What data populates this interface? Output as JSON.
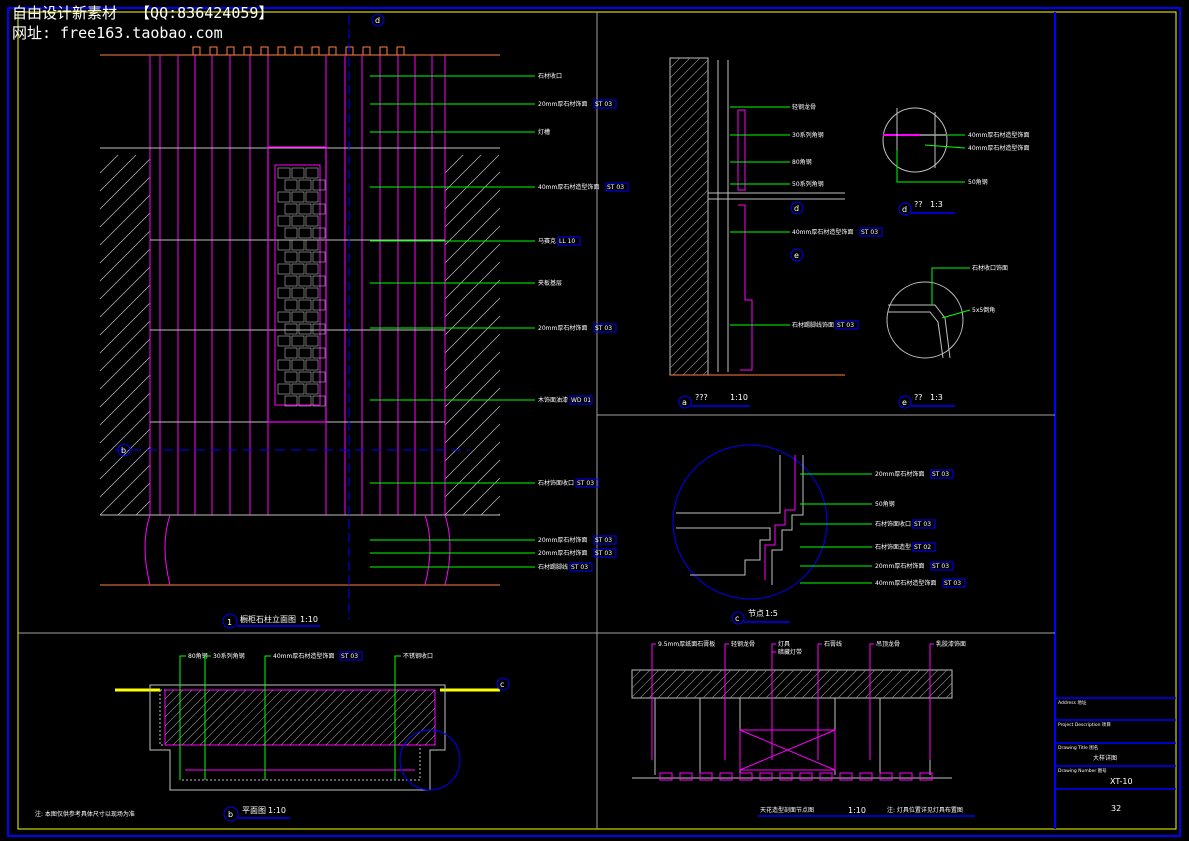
{
  "watermark": {
    "line1": "自由设计新素材  【QQ:836424059】",
    "line2": "网址: free163.taobao.com"
  },
  "colors": {
    "background": "#000000",
    "frame": "#ffff00",
    "border_blue": "#0000ff",
    "divider": "#a0a0a0",
    "leader": "#00ff00",
    "cabinet": "#ff00ff",
    "orange_line": "#ff8040",
    "hatch": "#c0c0c0"
  },
  "elevation": {
    "marker_top": "d",
    "marker_side": "b",
    "labels": [
      {
        "text": "石材收口",
        "code": ""
      },
      {
        "text": "20mm厚石材饰面",
        "code": "ST 03"
      },
      {
        "text": "灯槽",
        "code": ""
      },
      {
        "text": "40mm厚石材造型饰面",
        "code": "ST 03"
      },
      {
        "text": "马赛克",
        "code": "LL 10"
      },
      {
        "text": "夹板基层",
        "code": ""
      },
      {
        "text": "20mm厚石材饰面",
        "code": "ST 03"
      },
      {
        "text": "木饰面油漆",
        "code": "WD 01"
      },
      {
        "text": "石材饰面收口",
        "code": "ST 03"
      },
      {
        "text": "20mm厚石材饰面",
        "code": "ST 03"
      },
      {
        "text": "20mm厚石材饰面",
        "code": "ST 03"
      },
      {
        "text": "石材踢脚线",
        "code": "ST 03"
      }
    ],
    "caption": {
      "number": "1",
      "title": "橱柜石柱立面图",
      "scale": "1:10"
    }
  },
  "section_a": {
    "labels": [
      {
        "text": "轻钢龙骨",
        "code": ""
      },
      {
        "text": "30系列角钢",
        "code": ""
      },
      {
        "text": "80角钢",
        "code": ""
      },
      {
        "text": "50系列角钢",
        "code": ""
      },
      {
        "text": "40mm厚石材造型饰面",
        "code": "ST 03"
      },
      {
        "text": "石材踢脚线饰面",
        "code": "ST 03"
      }
    ],
    "markers": [
      "d",
      "e"
    ],
    "caption": {
      "number": "a",
      "title": "???",
      "scale": "1:10"
    }
  },
  "detail_d": {
    "labels": [
      "40mm厚石材造型饰面",
      "40mm厚石材造型饰面",
      "50角钢"
    ],
    "caption": {
      "number": "d",
      "title": "??",
      "scale": "1:3"
    }
  },
  "detail_e": {
    "labels": [
      "石材收口饰面",
      "5x5倒角"
    ],
    "caption": {
      "number": "e",
      "title": "??",
      "scale": "1:3"
    }
  },
  "detail_c": {
    "labels": [
      {
        "text": "20mm厚石材饰面",
        "code": "ST 03"
      },
      {
        "text": "50角钢",
        "code": ""
      },
      {
        "text": "石材饰面收口",
        "code": "ST 03"
      },
      {
        "text": "石材饰面造型",
        "code": "ST 02"
      },
      {
        "text": "20mm厚石材饰面",
        "code": "ST 03"
      },
      {
        "text": "40mm厚石材造型饰面",
        "code": "ST 03"
      }
    ],
    "caption": {
      "number": "c",
      "title": "节点",
      "scale": "1:5"
    }
  },
  "plan_b": {
    "labels": [
      {
        "text": "80角钢",
        "code": ""
      },
      {
        "text": "30系列角钢",
        "code": ""
      },
      {
        "text": "40mm厚石材造型饰面",
        "code": "ST 03"
      },
      {
        "text": "不锈钢收口",
        "code": ""
      }
    ],
    "marker": "c",
    "note": "注: 本图仅供参考具体尺寸以现场为准",
    "caption": {
      "number": "b",
      "title": "平面图",
      "scale": "1:10"
    }
  },
  "ceiling_elevation": {
    "labels": [
      "9.5mm厚纸面石膏板",
      "轻钢龙骨",
      "灯具",
      "暗藏灯带",
      "石膏线",
      "吊顶龙骨",
      "乳胶漆饰面"
    ],
    "caption_left": "天花造型剖面节点图",
    "scale": "1:10",
    "note": "注: 灯具位置详见灯具布置图"
  },
  "title_block": {
    "address_label": "Address 地址",
    "project_label": "Project Description 项目",
    "drawing_title_label": "Drawing Title 图名",
    "drawing_title": "大样详图",
    "drawing_number_label": "Drawing Number 图号",
    "drawing_number": "XT-10",
    "page": "32"
  }
}
